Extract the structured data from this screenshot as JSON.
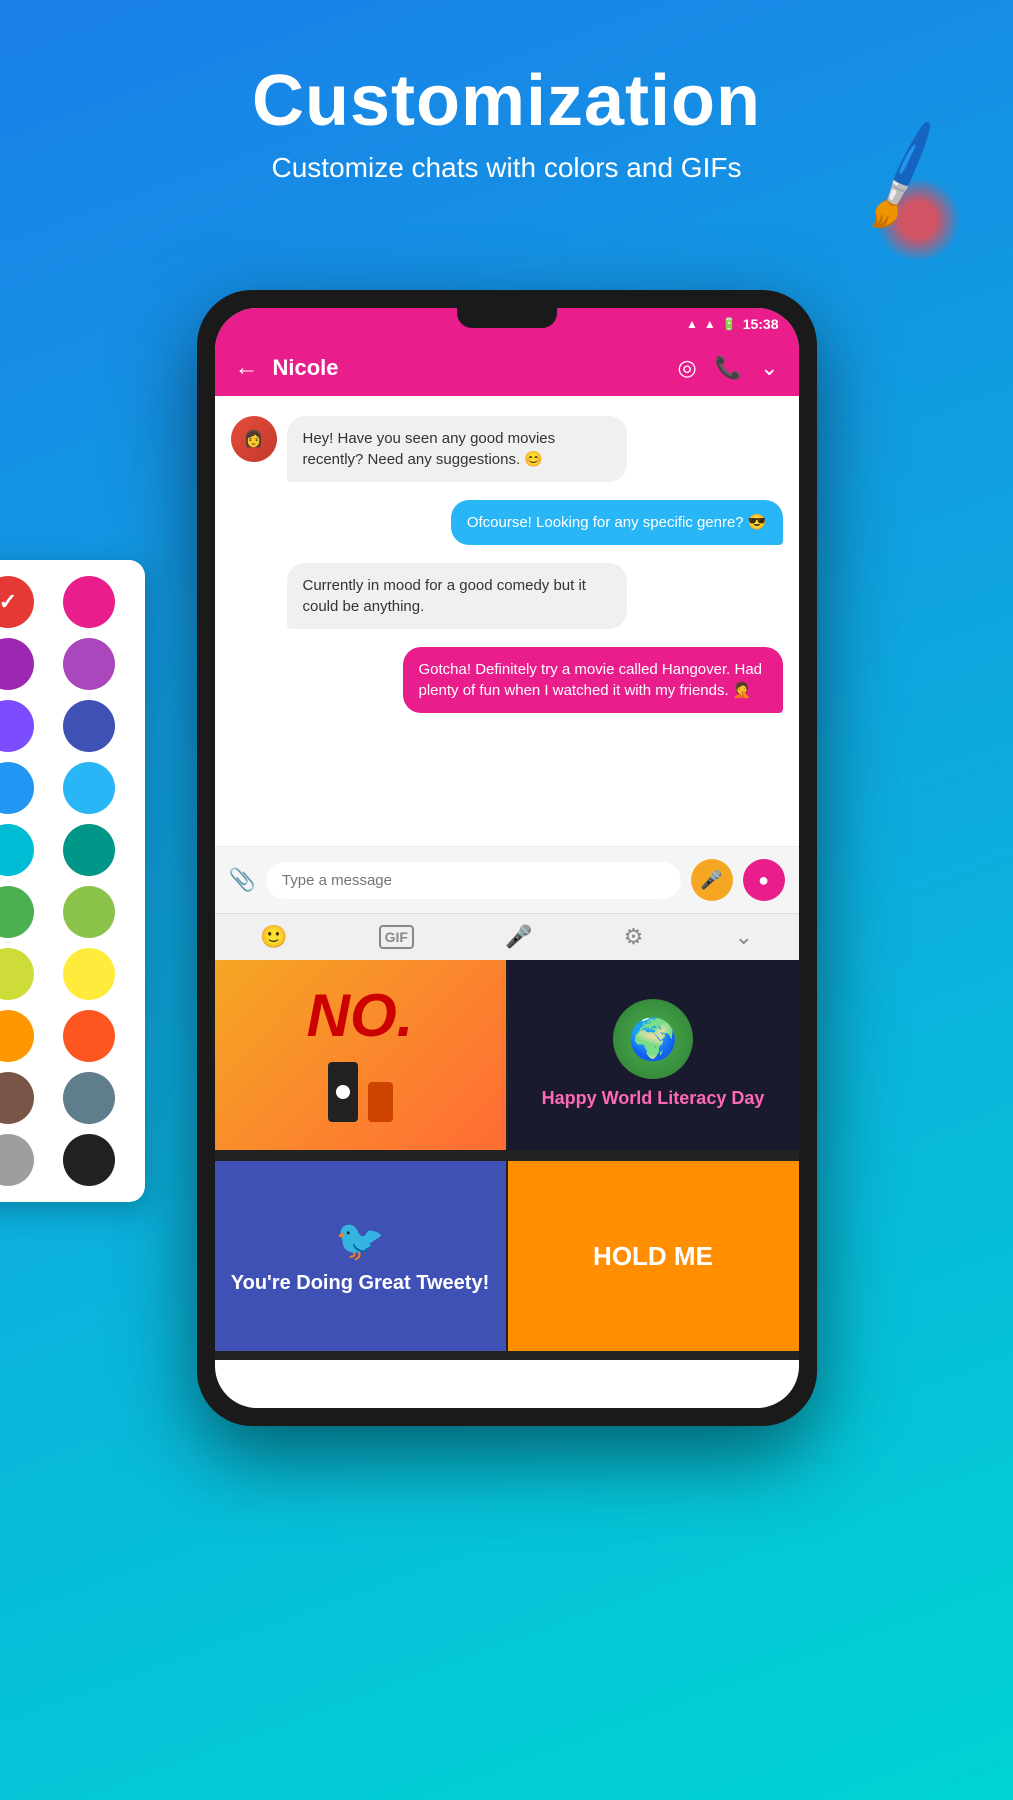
{
  "header": {
    "title": "Customization",
    "subtitle": "Customize chats with colors and GIFs"
  },
  "status_bar": {
    "time": "15:38"
  },
  "chat": {
    "contact_name": "Nicole",
    "messages": [
      {
        "id": 1,
        "type": "received",
        "text": "Hey! Have you seen any good movies recently? Need any suggestions. 😊",
        "has_avatar": true
      },
      {
        "id": 2,
        "type": "sent",
        "text": "Ofcourse! Looking for any specific genre? 😎",
        "color": "blue"
      },
      {
        "id": 3,
        "type": "received",
        "text": "Currently in mood for a good comedy but it could be anything.",
        "has_avatar": false
      },
      {
        "id": 4,
        "type": "sent",
        "text": "Gotcha! Definitely try a movie called Hangover. Had plenty of fun when I watched it with my friends. 🤦",
        "color": "pink"
      }
    ]
  },
  "input": {
    "placeholder": "Type a message"
  },
  "toolbar": {
    "items": [
      "emoji",
      "gif",
      "mic",
      "settings",
      "chevron-down"
    ]
  },
  "gif_panel": {
    "items": [
      {
        "id": 1,
        "label": "NO.",
        "type": "no"
      },
      {
        "id": 2,
        "label": "Happy World Literacy Day",
        "type": "literacy"
      },
      {
        "id": 3,
        "label": "You're Doing Great Tweety!",
        "type": "doing-great"
      },
      {
        "id": 4,
        "label": "HOLD ME",
        "type": "hold-me"
      }
    ]
  },
  "color_palette": {
    "colors": [
      {
        "id": 1,
        "hex": "#e53935",
        "selected": true
      },
      {
        "id": 2,
        "hex": "#e91e8c",
        "selected": false
      },
      {
        "id": 3,
        "hex": "#9c27b0",
        "selected": false
      },
      {
        "id": 4,
        "hex": "#ab47bc",
        "selected": false
      },
      {
        "id": 5,
        "hex": "#7c4dff",
        "selected": false
      },
      {
        "id": 6,
        "hex": "#3f51b5",
        "selected": false
      },
      {
        "id": 7,
        "hex": "#2196f3",
        "selected": false
      },
      {
        "id": 8,
        "hex": "#29b6f6",
        "selected": false
      },
      {
        "id": 9,
        "hex": "#00bcd4",
        "selected": false
      },
      {
        "id": 10,
        "hex": "#009688",
        "selected": false
      },
      {
        "id": 11,
        "hex": "#4caf50",
        "selected": false
      },
      {
        "id": 12,
        "hex": "#8bc34a",
        "selected": false
      },
      {
        "id": 13,
        "hex": "#cddc39",
        "selected": false
      },
      {
        "id": 14,
        "hex": "#ffeb3b",
        "selected": false
      },
      {
        "id": 15,
        "hex": "#ff9800",
        "selected": false
      },
      {
        "id": 16,
        "hex": "#ff5722",
        "selected": false
      },
      {
        "id": 17,
        "hex": "#795548",
        "selected": false
      },
      {
        "id": 18,
        "hex": "#607d8b",
        "selected": false
      },
      {
        "id": 19,
        "hex": "#9e9e9e",
        "selected": false
      },
      {
        "id": 20,
        "hex": "#212121",
        "selected": false
      }
    ]
  },
  "icons": {
    "back": "←",
    "broadcast": "📡",
    "phone": "📞",
    "chevron_down": "⌄",
    "attach": "📎",
    "mic": "🎤",
    "emoji": "🙂",
    "gif": "GIF",
    "settings": "⚙",
    "send": "➤"
  }
}
